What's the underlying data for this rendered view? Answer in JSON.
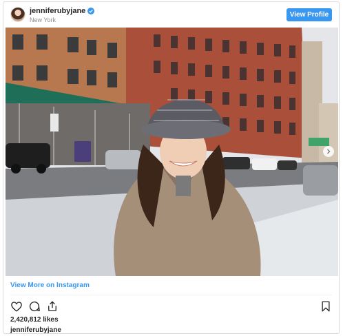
{
  "header": {
    "username": "jenniferubyjane",
    "location": "New York",
    "view_profile_label": "View Profile"
  },
  "post": {
    "image_alt": "Photo"
  },
  "footer": {
    "view_more_label": "View More on Instagram",
    "likes_text": "2,420,812 likes",
    "caption_username": "jenniferubyjane"
  },
  "colors": {
    "accent": "#3897f0",
    "text": "#262626",
    "muted": "#8e8e8e"
  },
  "icons": {
    "like": "heart-icon",
    "comment": "comment-icon",
    "share": "share-icon",
    "save": "bookmark-icon",
    "verified": "verified-badge-icon",
    "next": "chevron-right-icon"
  }
}
